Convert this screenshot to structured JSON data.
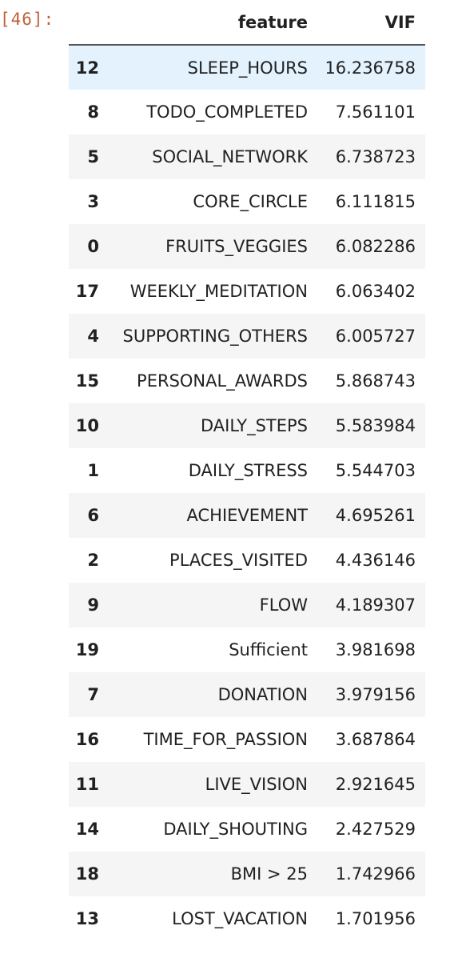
{
  "cell": {
    "prompt": "[46]:"
  },
  "table": {
    "columns": [
      "",
      "feature",
      "VIF"
    ],
    "rows": [
      {
        "index": "12",
        "feature": "SLEEP_HOURS",
        "vif": "16.236758"
      },
      {
        "index": "8",
        "feature": "TODO_COMPLETED",
        "vif": "7.561101"
      },
      {
        "index": "5",
        "feature": "SOCIAL_NETWORK",
        "vif": "6.738723"
      },
      {
        "index": "3",
        "feature": "CORE_CIRCLE",
        "vif": "6.111815"
      },
      {
        "index": "0",
        "feature": "FRUITS_VEGGIES",
        "vif": "6.082286"
      },
      {
        "index": "17",
        "feature": "WEEKLY_MEDITATION",
        "vif": "6.063402"
      },
      {
        "index": "4",
        "feature": "SUPPORTING_OTHERS",
        "vif": "6.005727"
      },
      {
        "index": "15",
        "feature": "PERSONAL_AWARDS",
        "vif": "5.868743"
      },
      {
        "index": "10",
        "feature": "DAILY_STEPS",
        "vif": "5.583984"
      },
      {
        "index": "1",
        "feature": "DAILY_STRESS",
        "vif": "5.544703"
      },
      {
        "index": "6",
        "feature": "ACHIEVEMENT",
        "vif": "4.695261"
      },
      {
        "index": "2",
        "feature": "PLACES_VISITED",
        "vif": "4.436146"
      },
      {
        "index": "9",
        "feature": "FLOW",
        "vif": "4.189307"
      },
      {
        "index": "19",
        "feature": "Sufficient",
        "vif": "3.981698"
      },
      {
        "index": "7",
        "feature": "DONATION",
        "vif": "3.979156"
      },
      {
        "index": "16",
        "feature": "TIME_FOR_PASSION",
        "vif": "3.687864"
      },
      {
        "index": "11",
        "feature": "LIVE_VISION",
        "vif": "2.921645"
      },
      {
        "index": "14",
        "feature": "DAILY_SHOUTING",
        "vif": "2.427529"
      },
      {
        "index": "18",
        "feature": "BMI > 25",
        "vif": "1.742966"
      },
      {
        "index": "13",
        "feature": "LOST_VACATION",
        "vif": "1.701956"
      }
    ],
    "hover_row": 0
  },
  "colors": {
    "prompt": "#c0603c",
    "stripe": "#f5f5f5",
    "hover": "#e3f2fd"
  }
}
